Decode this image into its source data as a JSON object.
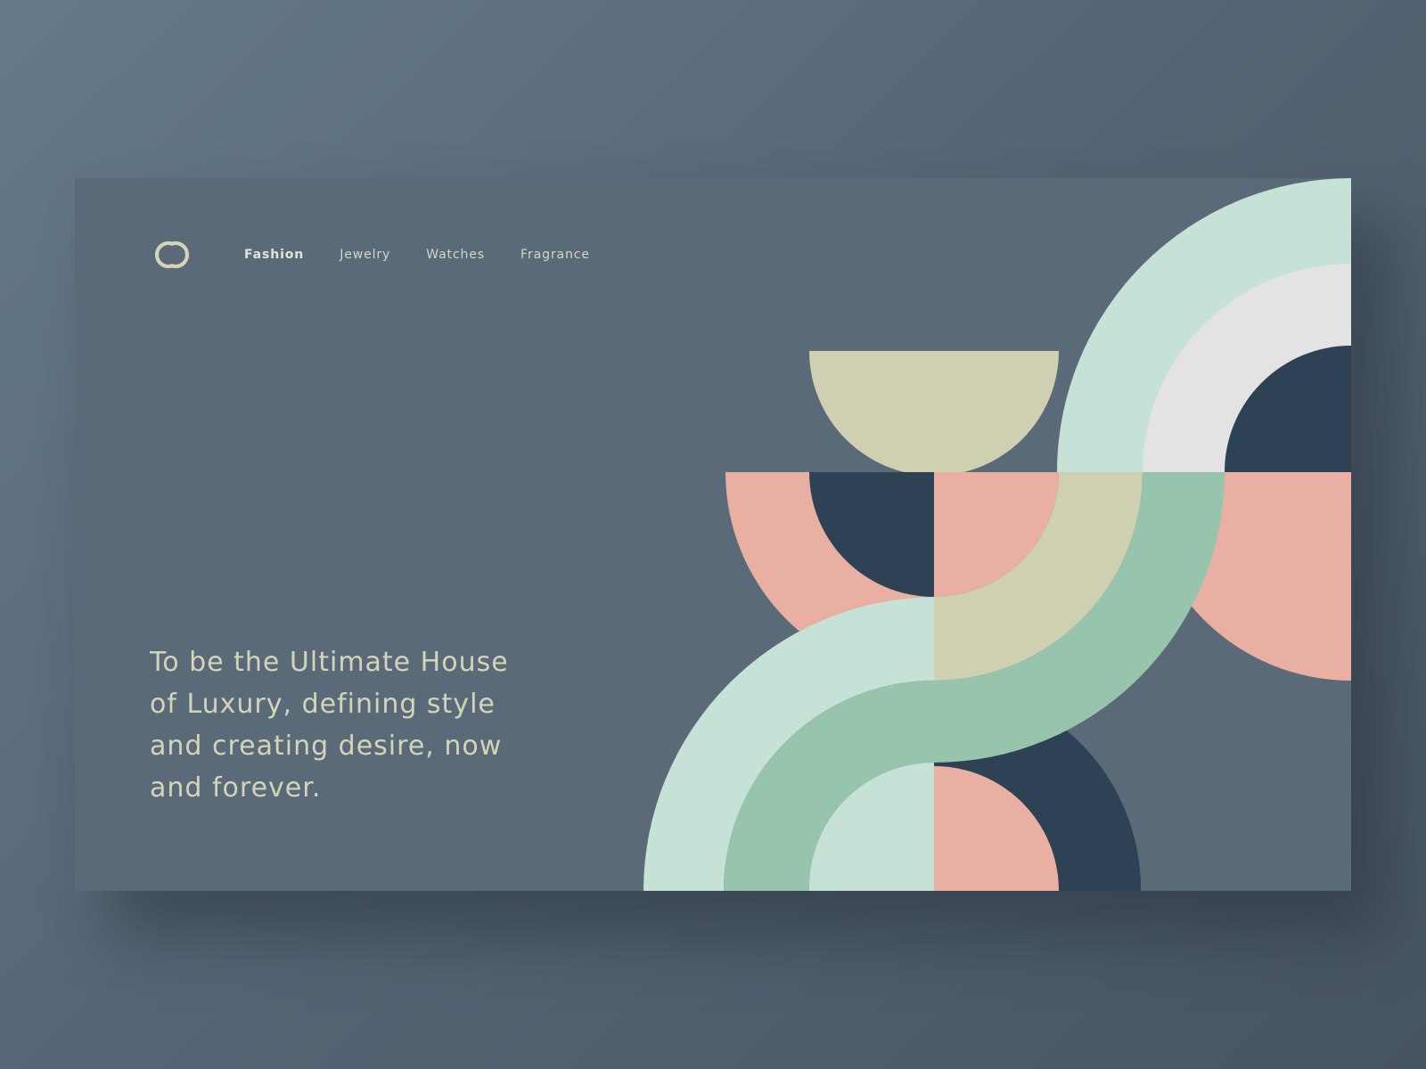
{
  "nav": {
    "logo_icon": "interlocking-cc-logo-icon",
    "items": [
      {
        "label": "Fashion",
        "active": true
      },
      {
        "label": "Jewelry",
        "active": false
      },
      {
        "label": "Watches",
        "active": false
      },
      {
        "label": "Fragrance",
        "active": false
      }
    ]
  },
  "hero": {
    "tagline": "To be the Ultimate House of Luxury, defining style and creating desire, now and forever."
  },
  "colors": {
    "page_background": "#5e7080",
    "card_background": "#5a6a79",
    "text": "#d3d4b8",
    "mint": "#c6e2d6",
    "sage": "#97c4ad",
    "khaki": "#cfcfb1",
    "pink": "#e9afa2",
    "navy": "#2e4155",
    "light_grey": "#e3e3e3"
  }
}
